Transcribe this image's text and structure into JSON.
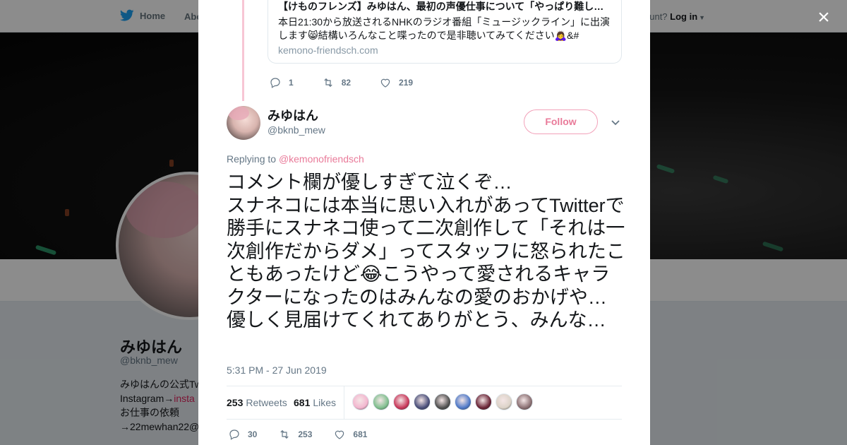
{
  "background": {
    "nav": {
      "home_label": "Home",
      "about_label": "Abo",
      "account_prompt": "ccount?",
      "login_label": "Log in"
    },
    "profile": {
      "name": "みゆはん",
      "handle": "@bknb_mew",
      "bio_lines": [
        "みゆはんの公式Tw",
        "Instagram→",
        "お仕事の依頼",
        "→22mewhan22@"
      ],
      "bio_link": "insta"
    }
  },
  "close_label": "×",
  "quoted_card": {
    "title": "【けものフレンズ】みゆはん、最初の声優仕事について「やっぱり難し…",
    "description": "本日21:30から放送されるNHKのラジオ番組「ミュージックライン」に出演します😸結構いろんなこと喋ったので是非聴いてみてください🙇‍♀️&#",
    "domain": "kemono-friendsch.com"
  },
  "quoted_actions": {
    "replies": "1",
    "retweets": "82",
    "likes": "219"
  },
  "tweet": {
    "author_name": "みゆはん",
    "author_handle": "@bknb_mew",
    "follow_label": "Follow",
    "replying_prefix": "Replying to",
    "replying_to": "@kemonofriendsch",
    "text_lines": [
      "コメント欄が優しすぎて泣くぞ…",
      "スナネコには本当に思い入れがあってTwitterで勝手にスナネコ使って二次創作して「それは一次創作だからダメ」ってスタッフに怒られたこともあったけど😂こうやって愛されるキャラクターになったのはみんなの愛のおかげや…優しく見届けてくれてありがとう、みんな…"
    ],
    "timestamp": "5:31 PM - 27 Jun 2019",
    "stats": {
      "retweets_count": "253",
      "retweets_label": "Retweets",
      "likes_count": "681",
      "likes_label": "Likes"
    },
    "actions": {
      "replies": "30",
      "retweets": "253",
      "likes": "681"
    },
    "liker_colors": [
      "#f3b6cf",
      "#7fbf8e",
      "#c8385a",
      "#4a4f7a",
      "#505050",
      "#4f79c8",
      "#6a2436",
      "#dcd3c8",
      "#8a6f72"
    ]
  },
  "colors": {
    "accent_pink": "#e97a99",
    "text_primary": "#14171a",
    "text_secondary": "#657786"
  }
}
